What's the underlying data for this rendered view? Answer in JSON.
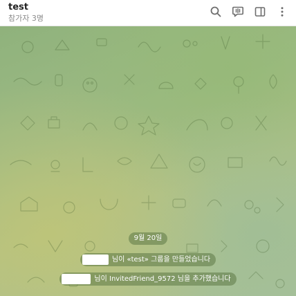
{
  "header": {
    "title": "test",
    "subtitle": "참가자 3명",
    "icons": [
      "search-icon",
      "video-chat-icon",
      "sidebar-toggle-icon",
      "more-vertical-icon"
    ]
  },
  "chat": {
    "date_label": "9월 20일",
    "service_messages": [
      {
        "text": "님이 «test» 그룹을 만들었습니다"
      },
      {
        "text": "님이 InvitedFriend_9572 님을 추가했습니다"
      }
    ]
  },
  "colors": {
    "header_bg": "#ffffff",
    "title": "#222222",
    "subtitle": "#8a8a8a",
    "icon": "#6d6d6d",
    "wallpaper_primary": "#9dba84",
    "pill_bg": "rgba(92,120,70,0.55)",
    "pill_text": "#ffffff"
  }
}
